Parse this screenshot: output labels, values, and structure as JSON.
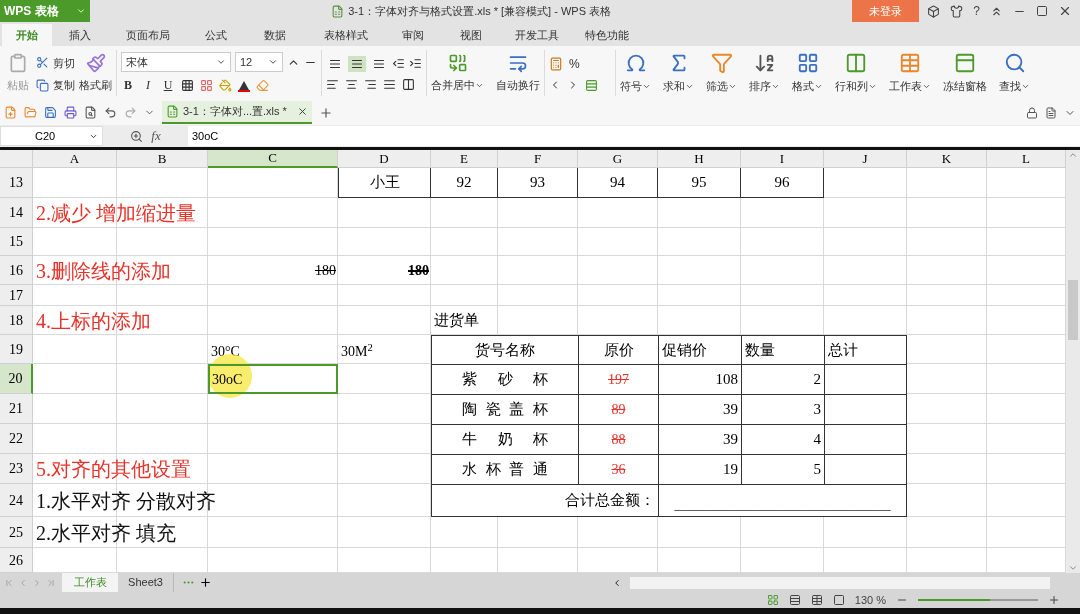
{
  "title_bar": {
    "app_button": "WPS 表格",
    "title": "3-1：字体对齐与格式设置.xls * [兼容模式] - WPS 表格",
    "login": "未登录",
    "help": "?"
  },
  "menu_tabs": [
    {
      "label": "开始",
      "selected": true
    },
    {
      "label": "插入",
      "selected": false
    },
    {
      "label": "页面布局",
      "selected": false
    },
    {
      "label": "公式",
      "selected": false
    },
    {
      "label": "数据",
      "selected": false
    },
    {
      "label": "表格样式",
      "selected": false
    },
    {
      "label": "审阅",
      "selected": false
    },
    {
      "label": "视图",
      "selected": false
    },
    {
      "label": "开发工具",
      "selected": false
    },
    {
      "label": "特色功能",
      "selected": false
    }
  ],
  "ribbon": {
    "paste": {
      "label": "粘贴",
      "disabled": true
    },
    "cut": "剪切",
    "copy": "复制",
    "format_painter": "格式刷",
    "font_name": "宋体",
    "font_size": "12",
    "style_buttons": [
      "B",
      "I",
      "U"
    ],
    "vertical_align": [
      {
        "selected": false
      },
      {
        "selected": true
      },
      {
        "selected": false
      }
    ],
    "merge_center": "合并居中",
    "wrap_text": "自动换行",
    "percent": "%",
    "tools": [
      {
        "label": "符号",
        "dropdown": true
      },
      {
        "label": "求和",
        "dropdown": true
      },
      {
        "label": "筛选",
        "dropdown": true
      },
      {
        "label": "排序",
        "dropdown": true
      },
      {
        "label": "格式",
        "dropdown": true
      },
      {
        "label": "行和列",
        "dropdown": true
      },
      {
        "label": "工作表",
        "dropdown": true
      },
      {
        "label": "冻结窗格",
        "dropdown": false
      },
      {
        "label": "查找",
        "dropdown": true
      }
    ]
  },
  "doc_tab": {
    "label": "3-1：字体对...置.xls *"
  },
  "formula_bar": {
    "cell_ref": "C20",
    "fx": "fx",
    "value": "30oC"
  },
  "sheet": {
    "columns": [
      {
        "label": "A",
        "selected": false
      },
      {
        "label": "B",
        "selected": false
      },
      {
        "label": "C",
        "selected": true
      },
      {
        "label": "D",
        "selected": false
      },
      {
        "label": "E",
        "selected": false
      },
      {
        "label": "F",
        "selected": false
      },
      {
        "label": "G",
        "selected": false
      },
      {
        "label": "H",
        "selected": false
      },
      {
        "label": "I",
        "selected": false
      },
      {
        "label": "J",
        "selected": false
      },
      {
        "label": "K",
        "selected": false
      },
      {
        "label": "L",
        "selected": false
      }
    ],
    "rows": [
      {
        "label": "13",
        "selected": false
      },
      {
        "label": "14",
        "selected": false
      },
      {
        "label": "15",
        "selected": false
      },
      {
        "label": "16",
        "selected": false
      },
      {
        "label": "17",
        "selected": false
      },
      {
        "label": "18",
        "selected": false
      },
      {
        "label": "19",
        "selected": false
      },
      {
        "label": "20",
        "selected": true
      },
      {
        "label": "21",
        "selected": false
      },
      {
        "label": "22",
        "selected": false
      },
      {
        "label": "23",
        "selected": false
      },
      {
        "label": "24",
        "selected": false
      },
      {
        "label": "25",
        "selected": false
      },
      {
        "label": "26",
        "selected": false
      }
    ],
    "score_row": {
      "name": "小王",
      "scores": [
        "92",
        "93",
        "94",
        "95",
        "96"
      ]
    },
    "notes": [
      {
        "text": "2.减少 增加缩进量",
        "color": "#e8322a"
      },
      {
        "text": "3.删除线的添加",
        "color": "#e8322a"
      },
      {
        "text": "4.上标的添加",
        "color": "#e8322a"
      },
      {
        "text": "5.对齐的其他设置",
        "color": "#e8322a"
      },
      {
        "text": "1.水平对齐 分散对齐",
        "color": "#111111"
      },
      {
        "text": "2.水平对齐 填充",
        "color": "#111111"
      }
    ],
    "strikethrough_values": [
      "180",
      "180"
    ],
    "superscript_examples": [
      "30°C",
      "30M$^{2}$"
    ],
    "active_cell": {
      "value": "30oC"
    }
  },
  "purchase_order": {
    "title": "进货单",
    "columns": [
      "货号名称",
      "原价",
      "促销价",
      "数量",
      "总计"
    ],
    "rows": [
      {
        "name": "紫砂杯",
        "original_price": "197",
        "promo_price": "108",
        "quantity": "2"
      },
      {
        "name": "陶瓷盖杯",
        "original_price": "89",
        "promo_price": "39",
        "quantity": "3"
      },
      {
        "name": "牛奶杯",
        "original_price": "88",
        "promo_price": "39",
        "quantity": "4"
      },
      {
        "name": "水杯普通",
        "original_price": "36",
        "promo_price": "19",
        "quantity": "5"
      }
    ],
    "total_label": "合计总金额：",
    "total_blank": "____________________________________"
  },
  "sheet_tabs": [
    {
      "label": "工作表",
      "selected": true
    },
    {
      "label": "Sheet3",
      "selected": false
    }
  ],
  "status_bar": {
    "zoom": "130 %",
    "zoom_slider": {
      "level": 0.6
    }
  }
}
